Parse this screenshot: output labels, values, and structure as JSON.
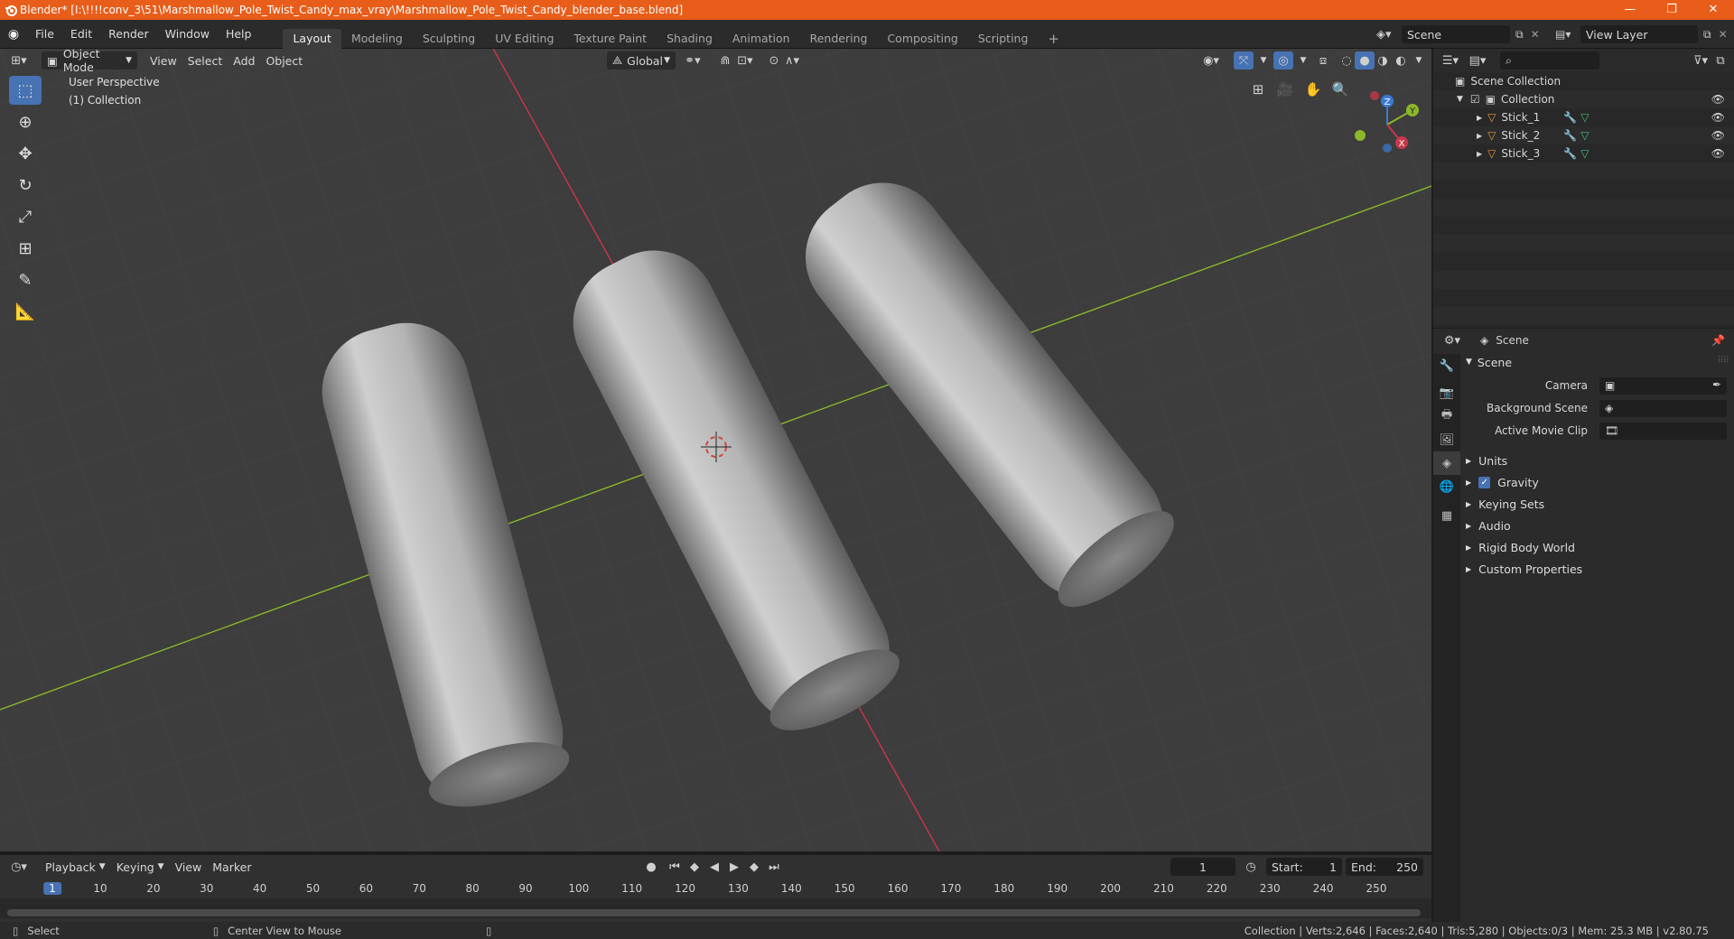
{
  "window": {
    "title": "Blender* [I:\\!!!!conv_3\\51\\Marshmallow_Pole_Twist_Candy_max_vray\\Marshmallow_Pole_Twist_Candy_blender_base.blend]",
    "minimize": "—",
    "maximize": "❐",
    "close": "✕"
  },
  "menu": [
    "File",
    "Edit",
    "Render",
    "Window",
    "Help"
  ],
  "workspaces": [
    "Layout",
    "Modeling",
    "Sculpting",
    "UV Editing",
    "Texture Paint",
    "Shading",
    "Animation",
    "Rendering",
    "Compositing",
    "Scripting"
  ],
  "active_workspace": "Layout",
  "add_workspace": "+",
  "scene_selector": "Scene",
  "view_layer_selector": "View Layer",
  "viewport": {
    "mode": "Object Mode",
    "menus": [
      "View",
      "Select",
      "Add",
      "Object"
    ],
    "transform_orientation": "Global",
    "perspective_label": "User Perspective",
    "collection_label": "(1) Collection",
    "gizmo_axes": {
      "x": "X",
      "y": "Y",
      "z": "Z"
    },
    "colors": {
      "x_axis": "#c8374a",
      "y_axis": "#8cb729",
      "z_axis": "#3b7ad6",
      "background": "#3d3d3d",
      "active_tool": "#4772b3"
    }
  },
  "timeline": {
    "menus": [
      "Playback",
      "Keying",
      "View",
      "Marker"
    ],
    "current_frame": "1",
    "start_label": "Start:",
    "start": "1",
    "end_label": "End:",
    "end": "250",
    "ruler": [
      "1",
      "10",
      "20",
      "30",
      "40",
      "50",
      "60",
      "70",
      "80",
      "90",
      "100",
      "110",
      "120",
      "130",
      "140",
      "150",
      "160",
      "170",
      "180",
      "190",
      "200",
      "210",
      "220",
      "230",
      "240",
      "250"
    ]
  },
  "statusbar": {
    "select": "Select",
    "center_view": "Center View to Mouse",
    "stats": "Collection | Verts:2,646 | Faces:2,640 | Tris:5,280 | Objects:0/3 | Mem: 25.3 MB | v2.80.75"
  },
  "outliner": {
    "scene_collection": "Scene Collection",
    "collection": "Collection",
    "objects": [
      "Stick_1",
      "Stick_2",
      "Stick_3"
    ]
  },
  "properties": {
    "header": "Scene",
    "panel": "Scene",
    "camera_label": "Camera",
    "background_scene_label": "Background Scene",
    "active_movie_clip_label": "Active Movie Clip",
    "subpanels": [
      "Units",
      "Gravity",
      "Keying Sets",
      "Audio",
      "Rigid Body World",
      "Custom Properties"
    ],
    "gravity_checked": true
  }
}
